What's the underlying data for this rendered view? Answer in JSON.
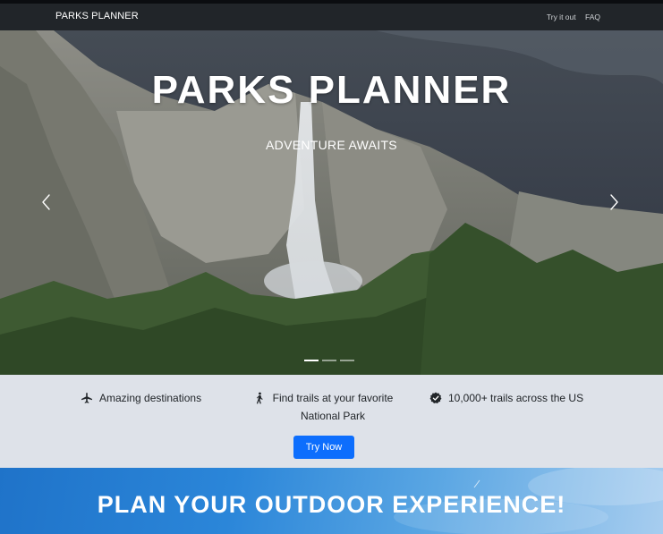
{
  "navbar": {
    "brand": "PARKS PLANNER",
    "links": [
      "Try it out",
      "FAQ"
    ]
  },
  "hero": {
    "title": "PARKS PLANNER",
    "subtitle": "ADVENTURE AWAITS",
    "prev_icon": "chevron-left-icon",
    "next_icon": "chevron-right-icon",
    "slides": 3,
    "active_slide": 1
  },
  "features": [
    {
      "icon": "airplane-icon",
      "text": "Amazing destinations"
    },
    {
      "icon": "hiker-icon",
      "text": "Find trails at your favorite National Park"
    },
    {
      "icon": "verified-badge-icon",
      "text": "10,000+ trails across the US"
    }
  ],
  "cta": {
    "label": "Try Now"
  },
  "plan_section": {
    "title": "PLAN YOUR OUTDOOR EXPERIENCE!"
  },
  "colors": {
    "navbar": "#212529",
    "features_bg": "#dee2e9",
    "button": "#0d6efd"
  }
}
